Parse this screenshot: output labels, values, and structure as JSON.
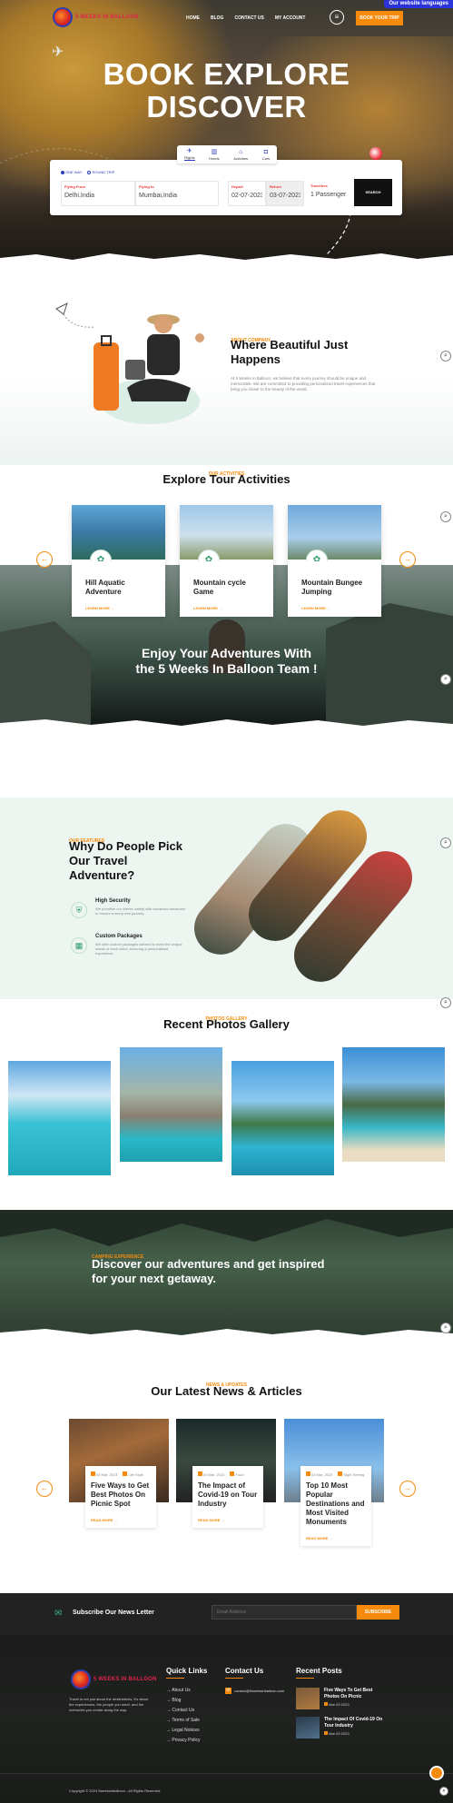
{
  "top_badge": "Our website languages",
  "nav": {
    "logo_text": "5 WEEKS IN BALLOON",
    "items": [
      "HOME",
      "BLOG",
      "CONTACT US",
      "MY ACCOUNT"
    ],
    "menu_icon": "≡",
    "book_label": "BOOK YOUR TRIP"
  },
  "hero": {
    "title_line1": "BOOK EXPLORE",
    "title_line2": "DISCOVER"
  },
  "search": {
    "tabs": [
      {
        "label": "Flights",
        "icon": "plane-icon"
      },
      {
        "label": "Hotels",
        "icon": "hotel-icon"
      },
      {
        "label": "Activities",
        "icon": "activity-icon"
      },
      {
        "label": "Cars",
        "icon": "car-icon"
      }
    ],
    "trip_types": [
      "ONE WAY",
      "ROUND TRIP"
    ],
    "fields": [
      {
        "label": "Flying From",
        "value": "Delhi,India"
      },
      {
        "label": "Flying to",
        "value": "Mumbai,India"
      },
      {
        "label": "Depart",
        "value": "02-07-2023"
      },
      {
        "label": "Return",
        "value": "03-07-2023"
      },
      {
        "label": "Travellers",
        "value": "1 Passenger"
      }
    ],
    "button": "SEARCH"
  },
  "about": {
    "tag": "ABOUT COMPANY",
    "title_line1": "Where Beautiful Just",
    "title_line2": "Happens",
    "text": "At 5 Weeks in Balloon, we believe that every journey should be unique and memorable. We are committed to providing personalized travel experiences that bring you closer to the beauty of the world."
  },
  "activities": {
    "tag": "OUR ACTIVITIES",
    "title": "Explore Tour Activities",
    "items": [
      {
        "title": "Hill Aquatic Adventure",
        "link": "LEARN MORE →"
      },
      {
        "title": "Mountain cycle Game",
        "link": "LEARN MORE →"
      },
      {
        "title": "Mountain Bungee Jumping",
        "link": "LEARN MORE →"
      }
    ],
    "prev": "←",
    "next": "→",
    "banner_line1": "Enjoy Your Adventures With",
    "banner_line2": "the 5 Weeks In Balloon Team !"
  },
  "why": {
    "tag": "OUR FEATURES",
    "title_line1": "Why Do People Pick",
    "title_line2": "Our Travel",
    "title_line3": "Adventure?",
    "features": [
      {
        "title": "High Security",
        "text": "We prioritize our clients' safety with advanced measures to ensure a worry-free journey."
      },
      {
        "title": "Custom Packages",
        "text": "We offer custom packages tailored to meet the unique needs of each client, ensuring a personalized experience."
      }
    ]
  },
  "gallery": {
    "tag": "PHOTOS GALLERY",
    "title": "Recent Photos Gallery"
  },
  "discover": {
    "tag": "CAMPING EXPERIENCE",
    "line1": "Discover our adventures and get inspired",
    "line2": "for your next getaway."
  },
  "news": {
    "tag": "NEWS & UPDATES",
    "title": "Our Latest News & Articles",
    "items": [
      {
        "date": "03 Mar, 2023",
        "cat": "Life Style",
        "title": "Five Ways to Get Best Photos On Picnic Spot",
        "link": "READ MORE →"
      },
      {
        "date": "03 Mar, 2023",
        "cat": "Food",
        "title": "The Impact of Covid-19 on Tour Industry",
        "link": "READ MORE →"
      },
      {
        "date": "03 Mar, 2023",
        "cat": "Sight Seeing",
        "title": "Top 10 Most Popular Destinations and Most Visited Monuments",
        "link": "READ MORE →"
      }
    ]
  },
  "newsletter": {
    "label": "Subscribe Our News Letter",
    "placeholder": "Email Address",
    "button": "SUBSCRIBE"
  },
  "footer": {
    "logo_text": "5 WEEKS IN BALLOON",
    "about": "Travel is not just about the destinations, it's about the experiences, the people you meet, and the memories you create along the way.",
    "quick_links_title": "Quick Links",
    "quick_links": [
      "About Us",
      "Blog",
      "Contact Us",
      "Terms of Sale",
      "Legal Notices",
      "Privacy Policy"
    ],
    "contact_title": "Contact Us",
    "email": "contact@5weeksinballoon.com",
    "posts_title": "Recent Posts",
    "posts": [
      {
        "title": "Five Ways To Get Best Photos On Picnic",
        "date": "Mar 03 2023"
      },
      {
        "title": "The Impact Of Covid-19 On Tour Industry",
        "date": "Mar 03 2023"
      }
    ],
    "copyright": "Copyright © 2024 5weeksinballoon - All Rights Reserved."
  }
}
